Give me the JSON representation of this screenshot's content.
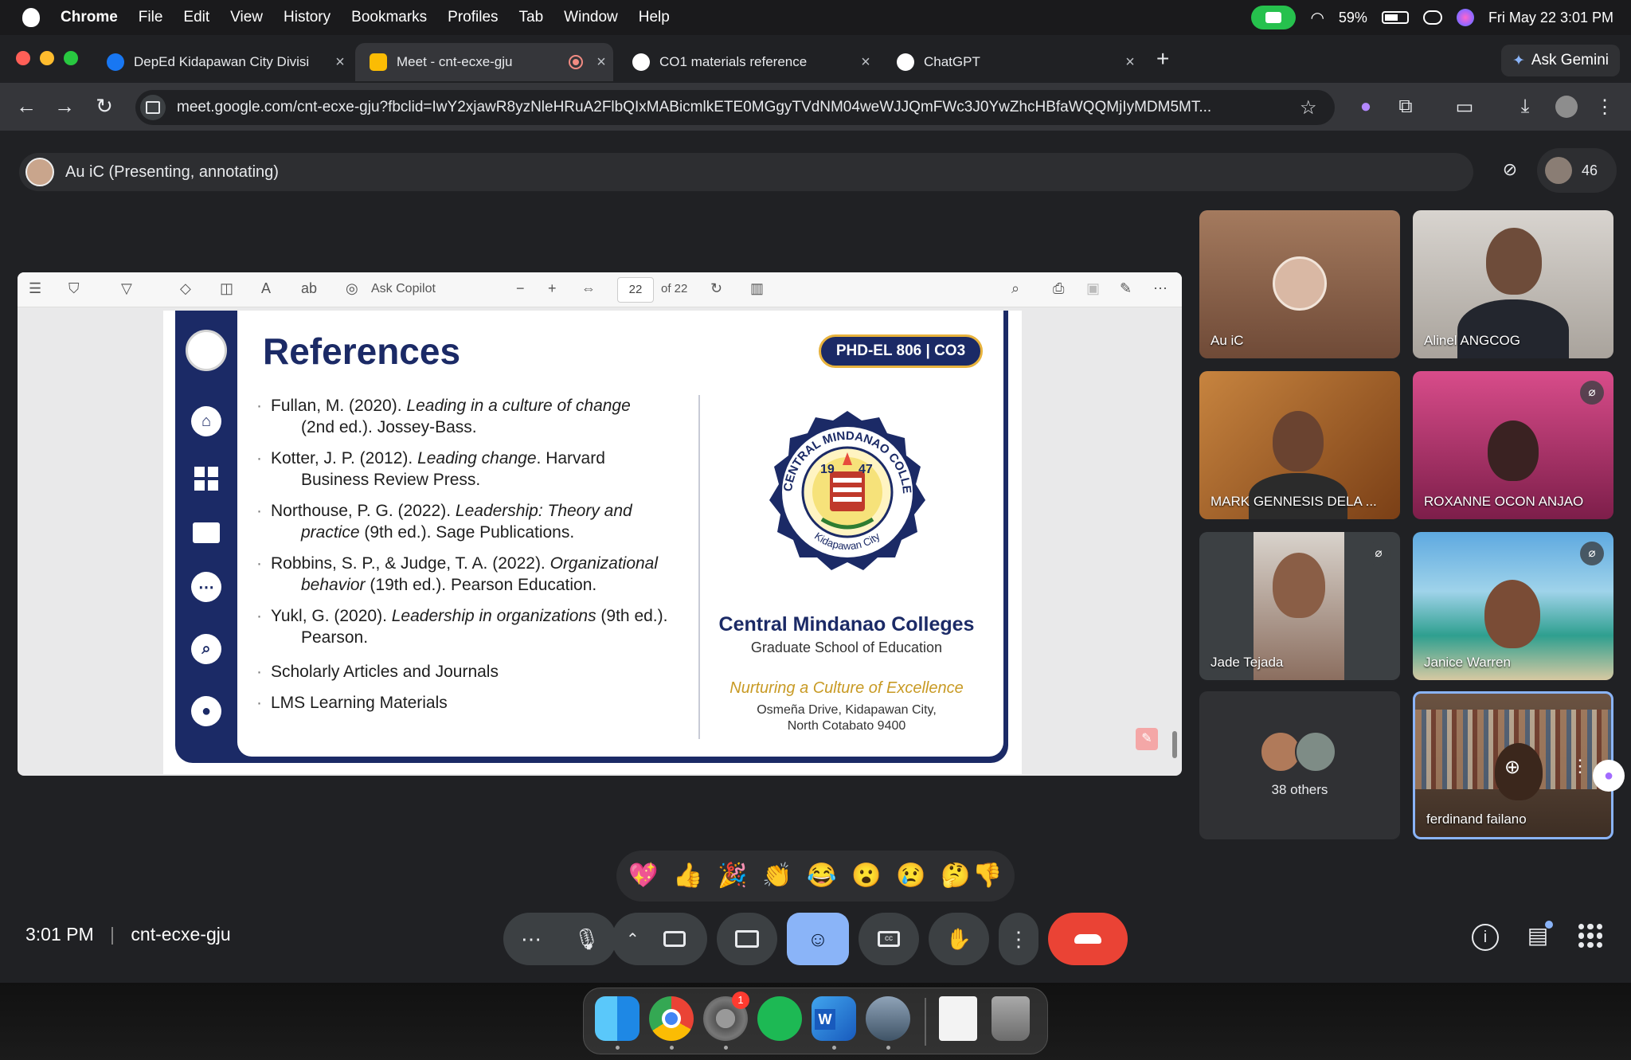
{
  "menubar": {
    "app": "Chrome",
    "items": [
      "File",
      "Edit",
      "View",
      "History",
      "Bookmarks",
      "Profiles",
      "Tab",
      "Window",
      "Help"
    ],
    "battery": "59%",
    "datetime": "Fri May 22  3:01 PM"
  },
  "tabs": [
    {
      "label": "DepEd Kidapawan City Divisi",
      "favicon_color": "#1877f2",
      "active": false
    },
    {
      "label": "Meet - cnt-ecxe-gju",
      "favicon_color": "#fbbc04",
      "active": true
    },
    {
      "label": "CO1 materials reference",
      "favicon_color": "#9aa0a6",
      "active": false
    },
    {
      "label": "ChatGPT",
      "favicon_color": "#9aa0a6",
      "active": false
    }
  ],
  "ask_gemini": "Ask Gemini",
  "address": {
    "url": "meet.google.com/cnt-ecxe-gju?fbclid=IwY2xjawR8yzNleHRuA2FlbQIxMABicmlkETE0MGgyTVdNM04weWJJQmFWc3J0YwZhcHBfaWQQMjIyMDM5MT..."
  },
  "meet": {
    "presenting_label": "Au iC (Presenting, annotating)",
    "participant_count": "46",
    "clock": "3:01 PM",
    "meeting_code": "cnt-ecxe-gju"
  },
  "pdf": {
    "ask_copilot": "Ask Copilot",
    "page": "22",
    "of_pages": "of 22"
  },
  "slide": {
    "title": "References",
    "badge": "PHD-EL 806 | CO3",
    "refs": [
      {
        "a": "Fullan, M. (2020). ",
        "b": "Leading in a culture of change",
        "c": "",
        "d": "(2nd ed.). Jossey-Bass."
      },
      {
        "a": "Kotter, J. P. (2012). ",
        "b": "Leading change",
        "c": ". Harvard",
        "d": "Business Review Press."
      },
      {
        "a": "Northouse, P. G. (2022). ",
        "b": "Leadership: Theory and",
        "c": "",
        "d_i": "practice",
        "d": " (9th ed.). Sage Publications."
      },
      {
        "a": "Robbins, S. P., & Judge, T. A. (2022). ",
        "b": "Organizational",
        "c": "",
        "d_i": "behavior",
        "d": " (19th ed.). Pearson Education."
      },
      {
        "a": "Yukl, G. (2020). ",
        "b": "Leadership in organizations",
        "c": " (9th ed.).",
        "d": "Pearson."
      }
    ],
    "extra_items": [
      "Scholarly Articles and Journals",
      "LMS Learning Materials"
    ],
    "seal_top": "CENTRAL MINDANAO COLLEGES",
    "seal_year_left": "19",
    "seal_year_right": "47",
    "seal_bottom": "Kidapawan City",
    "school": "Central Mindanao Colleges",
    "school_sub": "Graduate School of Education",
    "motto": "Nurturing a Culture of Excellence",
    "address_line1": "Osmeña Drive, Kidapawan City,",
    "address_line2": "North Cotabato 9400"
  },
  "participants": [
    {
      "name": "Au iC",
      "muted": false
    },
    {
      "name": "Alinel ANGCOG",
      "muted": false
    },
    {
      "name": "MARK GENNESIS DELA ...",
      "muted": false
    },
    {
      "name": "ROXANNE OCON ANJAO",
      "muted": true
    },
    {
      "name": "Jade Tejada",
      "muted": true
    },
    {
      "name": "Janice Warren",
      "muted": true
    },
    {
      "name": "38 others",
      "muted": false
    },
    {
      "name": "ferdinand failano",
      "muted": false
    }
  ],
  "reactions": [
    "💖",
    "👍",
    "🎉",
    "👏",
    "😂",
    "😮",
    "😢",
    "🤔",
    "👎"
  ]
}
